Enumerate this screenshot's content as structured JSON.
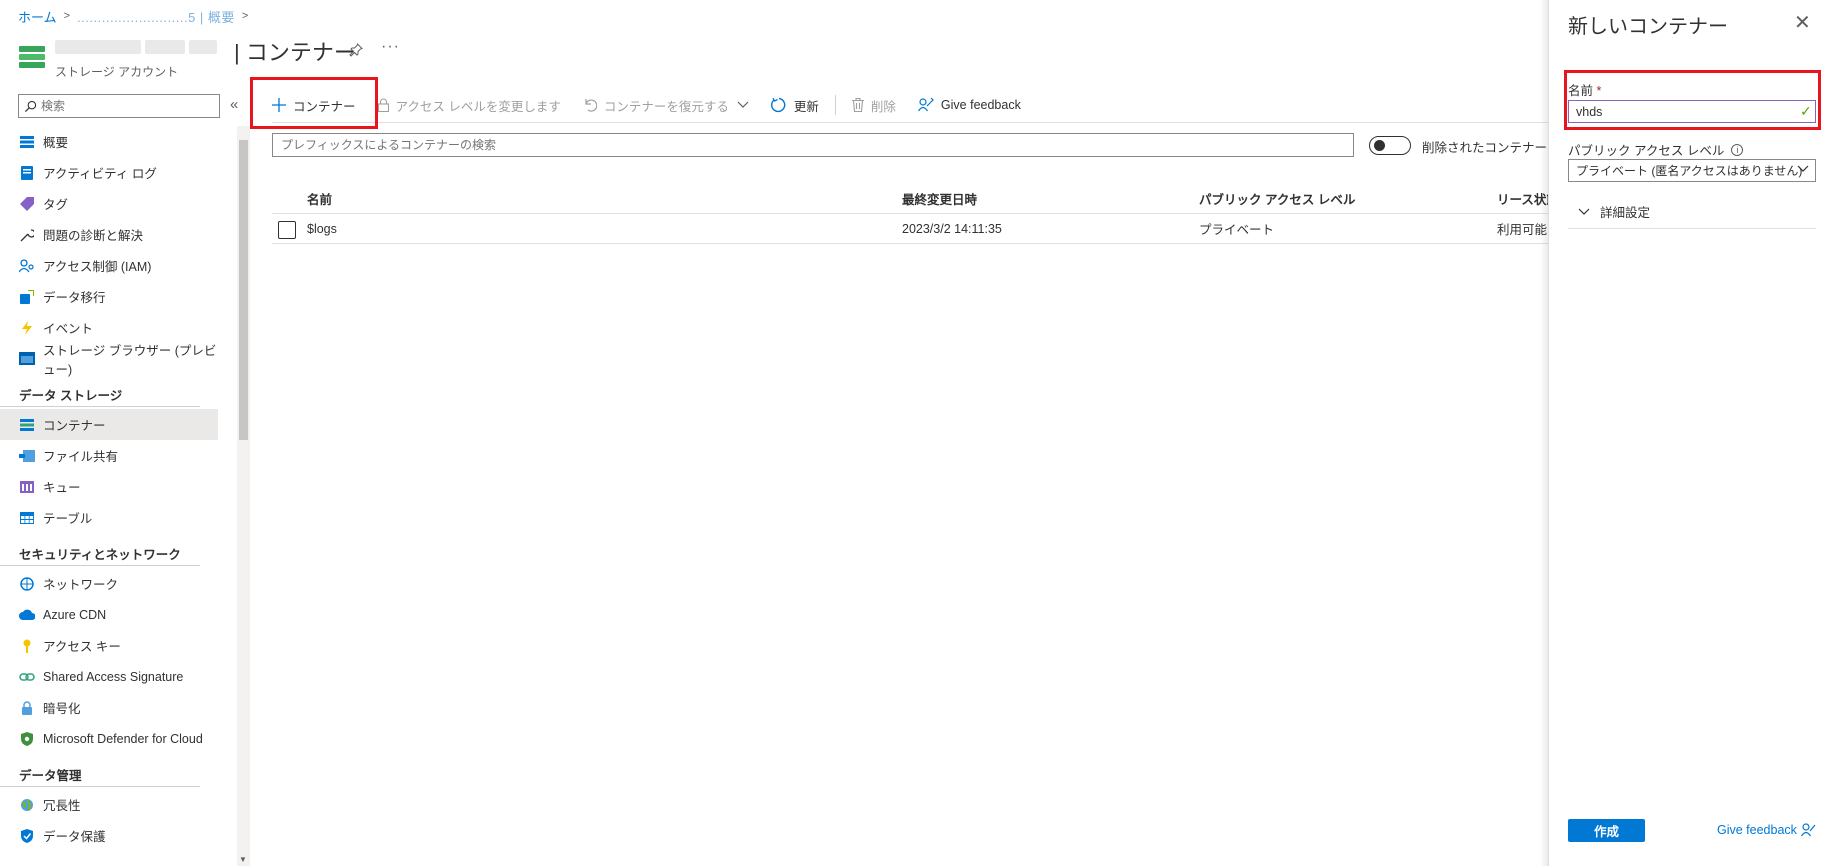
{
  "breadcrumb": {
    "home": "ホーム",
    "resource": "...........................5 | 概要"
  },
  "header": {
    "subtitle": "ストレージ アカウント",
    "title": "| コンテナー",
    "more": "···"
  },
  "sidebar": {
    "search_placeholder": "検索",
    "collapse": "«",
    "items_top": [
      {
        "label": "概要",
        "icon": "overview-icon"
      },
      {
        "label": "アクティビティ ログ",
        "icon": "activity-log-icon"
      },
      {
        "label": "タグ",
        "icon": "tag-icon"
      },
      {
        "label": "問題の診断と解決",
        "icon": "wrench-icon"
      },
      {
        "label": "アクセス制御 (IAM)",
        "icon": "iam-icon"
      },
      {
        "label": "データ移行",
        "icon": "data-migration-icon"
      },
      {
        "label": "イベント",
        "icon": "lightning-icon"
      },
      {
        "label": "ストレージ ブラウザー (プレビュー)",
        "icon": "storage-browser-icon"
      }
    ],
    "group_data_storage": "データ ストレージ",
    "items_storage": [
      {
        "label": "コンテナー",
        "icon": "container-icon"
      },
      {
        "label": "ファイル共有",
        "icon": "file-share-icon"
      },
      {
        "label": "キュー",
        "icon": "queue-icon"
      },
      {
        "label": "テーブル",
        "icon": "table-icon"
      }
    ],
    "group_security": "セキュリティとネットワーク",
    "items_security": [
      {
        "label": "ネットワーク",
        "icon": "network-icon"
      },
      {
        "label": "Azure CDN",
        "icon": "cdn-icon"
      },
      {
        "label": "アクセス キー",
        "icon": "key-icon"
      },
      {
        "label": "Shared Access Signature",
        "icon": "link-icon"
      },
      {
        "label": "暗号化",
        "icon": "lock-icon"
      },
      {
        "label": "Microsoft Defender for Cloud",
        "icon": "shield-icon"
      }
    ],
    "group_data_mgmt": "データ管理",
    "items_mgmt": [
      {
        "label": "冗長性",
        "icon": "globe-icon"
      },
      {
        "label": "データ保護",
        "icon": "protection-icon"
      }
    ]
  },
  "toolbar": {
    "add_container": "コンテナー",
    "change_access": "アクセス レベルを変更します",
    "restore": "コンテナーを復元する",
    "refresh": "更新",
    "delete": "削除",
    "feedback": "Give feedback"
  },
  "filter": {
    "placeholder": "プレフィックスによるコンテナーの検索",
    "toggle_label": "削除されたコンテナーを表示"
  },
  "table": {
    "headers": [
      "名前",
      "最終変更日時",
      "パブリック アクセス レベル",
      "リース状態"
    ],
    "rows": [
      {
        "name": "$logs",
        "modified": "2023/3/2 14:11:35",
        "access": "プライベート",
        "lease": "利用可能"
      }
    ]
  },
  "panel": {
    "title": "新しいコンテナー",
    "close": "✕",
    "name_label": "名前",
    "required_mark": "*",
    "name_value": "vhds",
    "access_label": "パブリック アクセス レベル",
    "access_value": "プライベート (匿名アクセスはありません)",
    "advanced": "詳細設定",
    "create": "作成",
    "feedback": "Give feedback"
  },
  "colors": {
    "accent": "#0078d4",
    "highlight": "#e8141e",
    "input_focus": "#8764b8"
  }
}
